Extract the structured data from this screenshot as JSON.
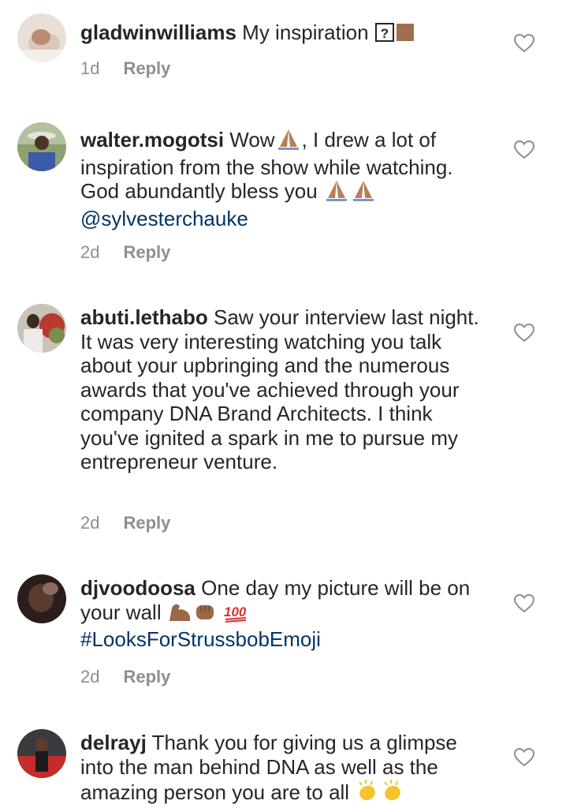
{
  "comments": [
    {
      "username": "gladwinwilliams",
      "text_before": " My inspiration ",
      "text_after": "",
      "emoji": [
        "question-box",
        "brown-square"
      ],
      "time": "1d",
      "reply": "Reply"
    },
    {
      "username": "walter.mogotsi",
      "text_a": " Wow",
      "text_b": ", I drew a lot of inspiration from the show while watching. God abundantly bless you ",
      "mention": "@sylvesterchauke",
      "emoji": [
        "folded-hands",
        "folded-hands",
        "folded-hands"
      ],
      "time": "2d",
      "reply": "Reply"
    },
    {
      "username": "abuti.lethabo",
      "text": " Saw your interview last night. It was very interesting watching you talk about your upbringing and the numerous awards that you've achieved through your company DNA Brand Architects. I think you've ignited a spark in me to pursue my entrepreneur venture.",
      "time": "2d",
      "reply": "Reply"
    },
    {
      "username": "djvoodoosa",
      "text": " One day my picture will be on your wall ",
      "hashtag": "#LooksForStrussbobEmoji",
      "emoji": [
        "flexed-biceps",
        "fist",
        "hundred-points"
      ],
      "time": "2d",
      "reply": "Reply"
    },
    {
      "username": "delrayj",
      "text": " Thank you for giving us a glimpse into the man behind DNA as well as the amazing person you are to all ",
      "emoji": [
        "clapping-hands",
        "clapping-hands"
      ]
    }
  ],
  "colors": {
    "text": "#262626",
    "meta": "#8e8e8e",
    "link": "#003569",
    "heart": "#8e8e8e"
  }
}
